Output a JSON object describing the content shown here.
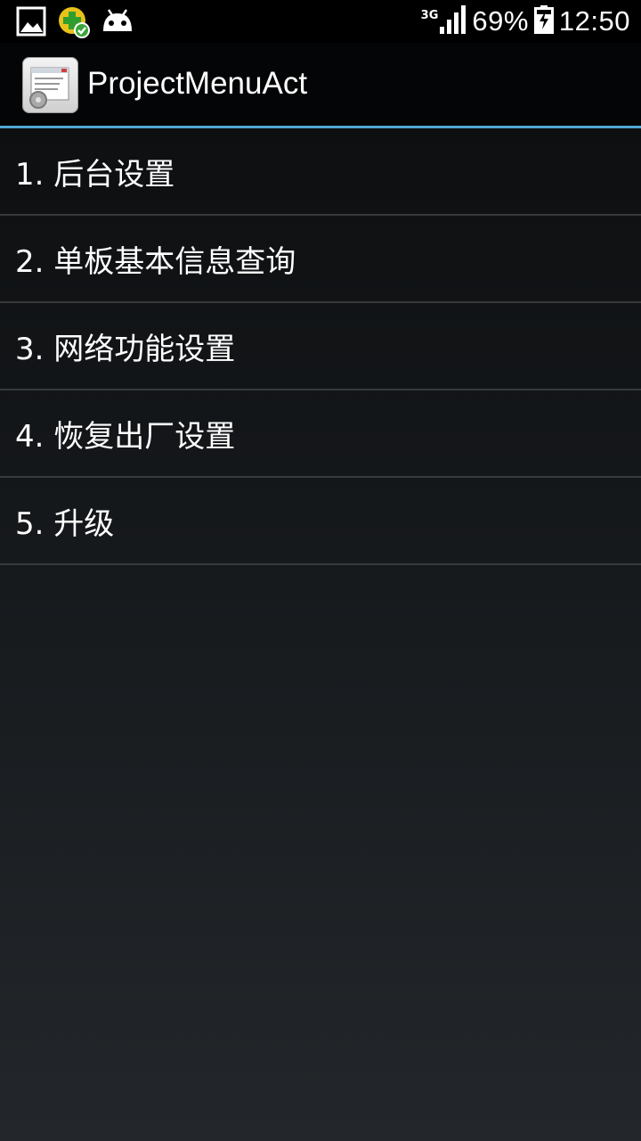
{
  "status_bar": {
    "notification_icons": [
      "image-icon",
      "app-update-icon",
      "android-icon"
    ],
    "network_type": "3G",
    "battery": "69%",
    "time": "12:50"
  },
  "action_bar": {
    "icon": "app-icon",
    "title": "ProjectMenuAct",
    "accent_color": "#4fa8d6"
  },
  "menu": {
    "items": [
      {
        "label": "1. 后台设置"
      },
      {
        "label": "2. 单板基本信息查询"
      },
      {
        "label": "3. 网络功能设置"
      },
      {
        "label": "4. 恢复出厂设置"
      },
      {
        "label": "5. 升级"
      }
    ]
  }
}
